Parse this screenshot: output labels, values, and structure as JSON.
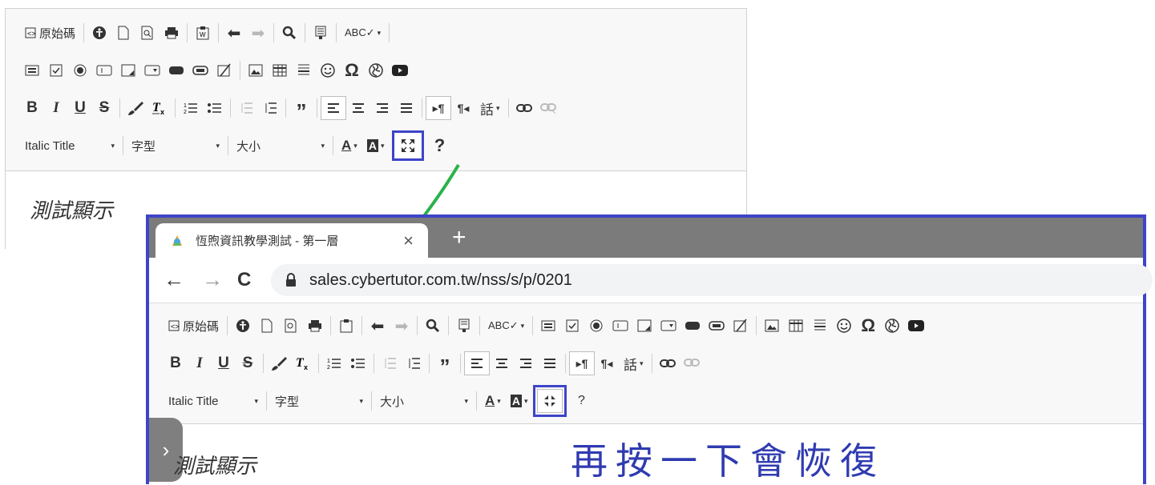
{
  "editor": {
    "row1": {
      "source": "原始碼",
      "icons": [
        "accessibility-icon",
        "new-page-icon",
        "preview-icon",
        "print-icon",
        "paste-from-word-icon",
        "undo-icon",
        "redo-icon",
        "find-icon",
        "find-replace-icon",
        "spellcheck-icon"
      ]
    },
    "row2_icons": [
      "form-icon",
      "checkbox-icon",
      "radio-icon",
      "textfield-icon",
      "textarea-icon",
      "select-icon",
      "button-icon",
      "imagebutton-icon",
      "hiddenfield-icon",
      "image-icon",
      "table-icon",
      "horizontal-rule-icon",
      "smiley-icon",
      "special-char-icon",
      "iframe-icon",
      "youtube-icon"
    ],
    "row3": {
      "bold": "B",
      "italic": "I",
      "underline": "U",
      "strike": "S",
      "omega": "Ω",
      "language": "話"
    },
    "row4": {
      "style": "Italic Title",
      "font": "字型",
      "size": "大小",
      "text_color": "A",
      "bg_color": "A",
      "help": "?"
    },
    "content": "測試顯示"
  },
  "browser": {
    "tab_title": "恆煦資訊教學測試 - 第一層",
    "new_tab": "+",
    "tab_close": "×",
    "url": "sales.cybertutor.com.tw/nss/s/p/0201",
    "back": "←",
    "forward": "→",
    "reload": "C"
  },
  "annotation": "再按一下會恢復",
  "colors": {
    "highlight": "#3e44c8",
    "arrow": "#2bb24c",
    "tabbar": "#7b7b7b"
  }
}
